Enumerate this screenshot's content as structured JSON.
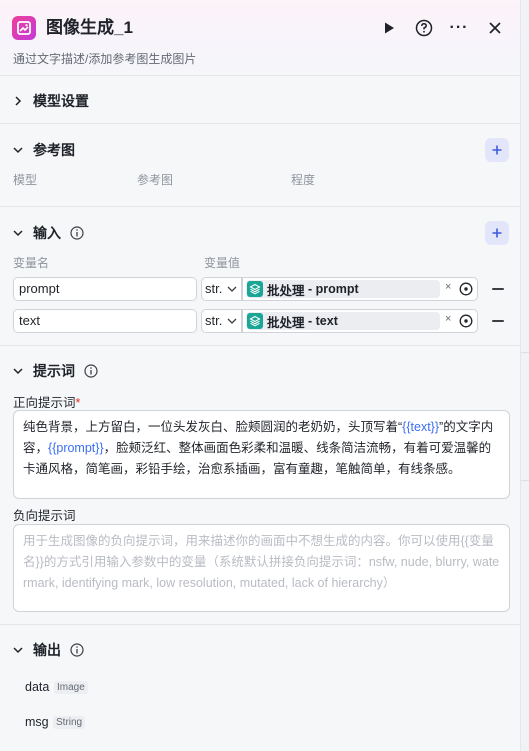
{
  "header": {
    "title": "图像生成_1",
    "subtitle": "通过文字描述/添加参考图生成图片",
    "more_glyph": "···",
    "icons": [
      "image-node-icon",
      "play-icon",
      "help-icon",
      "more-icon",
      "close-icon"
    ]
  },
  "model_settings": {
    "title": "模型设置"
  },
  "reference": {
    "title": "参考图",
    "columns": [
      "模型",
      "参考图",
      "程度"
    ]
  },
  "inputs": {
    "title": "输入",
    "col_name": "变量名",
    "col_value": "变量值",
    "rows": [
      {
        "name": "prompt",
        "type": "str.",
        "ref_source": "批处理",
        "ref_sep": " - ",
        "ref_var": "prompt",
        "remove": "×"
      },
      {
        "name": "text",
        "type": "str.",
        "ref_source": "批处理",
        "ref_sep": " - ",
        "ref_var": "text",
        "remove": "×"
      }
    ]
  },
  "prompts": {
    "title": "提示词",
    "positive_label": "正向提示词",
    "required_mark": "*",
    "positive_parts": [
      {
        "text": "纯色背景，上方留白，一位头发灰白、脸颊圆润的老奶奶，头顶写着“",
        "var": false
      },
      {
        "text": "{{text}}",
        "var": true
      },
      {
        "text": "”的文字内容，",
        "var": false
      },
      {
        "text": "{{prompt}}",
        "var": true
      },
      {
        "text": "，脸颊泛红、整体画面色彩柔和温暖、线条简洁流畅，有着可爱温馨的卡通风格，简笔画，彩铅手绘，治愈系插画，富有童趣，笔触简单，有线条感。",
        "var": false
      }
    ],
    "negative_label": "负向提示词",
    "negative_placeholder": "用于生成图像的负向提示词，用来描述你的画面中不想生成的内容。你可以使用{{变量名}}的方式引用输入参数中的变量（系统默认拼接负向提示词：nsfw, nude, blurry, watermark, identifying mark, low resolution, mutated, lack of hierarchy）"
  },
  "outputs": {
    "title": "输出",
    "items": [
      {
        "name": "data",
        "type": "Image"
      },
      {
        "name": "msg",
        "type": "String"
      }
    ]
  },
  "colors": {
    "accent": "#3b6ef5",
    "brand": "#e63fa6",
    "required": "#e0302c",
    "node": "#1aa595"
  }
}
